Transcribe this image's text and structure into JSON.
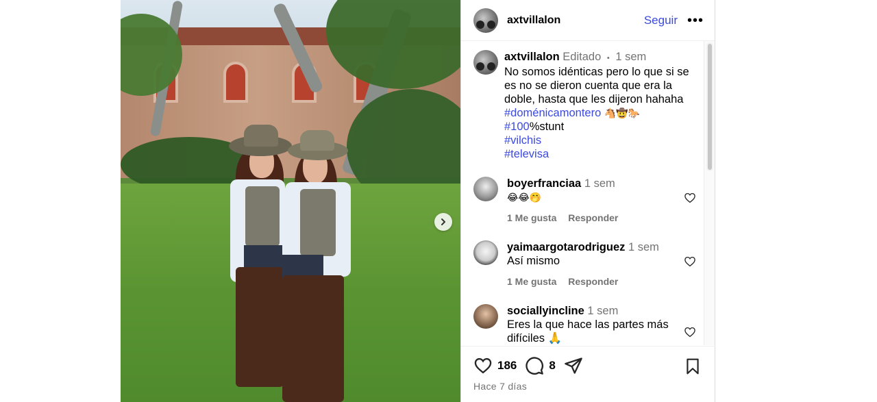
{
  "post": {
    "author": "axtvillalon",
    "follow_label": "Seguir",
    "more_label": "•••"
  },
  "caption": {
    "username": "axtvillalon",
    "edited": "Editado",
    "dot": "•",
    "time": "1 sem",
    "text": "No somos idénticas pero lo que si se es no se dieron cuenta que era la doble, hasta que les dijeron hahaha",
    "hashtag1": "#doménicamontero",
    "emojis1": "🐴🤠🐎",
    "hashtag2": "#100",
    "hashtag2_suffix": "%stunt",
    "hashtag3": "#vilchis",
    "hashtag4": "#televisa"
  },
  "comments": [
    {
      "username": "boyerfranciaa",
      "time": "1 sem",
      "text": "😂😂🤭",
      "likes": "1 Me gusta",
      "reply": "Responder"
    },
    {
      "username": "yaimaargotarodriguez",
      "time": "1 sem",
      "text": "Así mismo",
      "likes": "1 Me gusta",
      "reply": "Responder"
    },
    {
      "username": "sociallyincline",
      "time": "1 sem",
      "text": "Eres la que hace las partes más difíciles 🙏",
      "likes": "",
      "reply": ""
    }
  ],
  "actions": {
    "likes_count": "186",
    "comments_count": "8",
    "posted": "Hace 7 días"
  },
  "icons": {
    "like": "heart-icon",
    "comment": "comment-icon",
    "share": "share-icon",
    "save": "bookmark-icon",
    "next": "chevron-right-icon",
    "more": "more-icon"
  },
  "colors": {
    "link": "#3b49df",
    "muted": "#737373",
    "border": "#dbdbdb"
  }
}
